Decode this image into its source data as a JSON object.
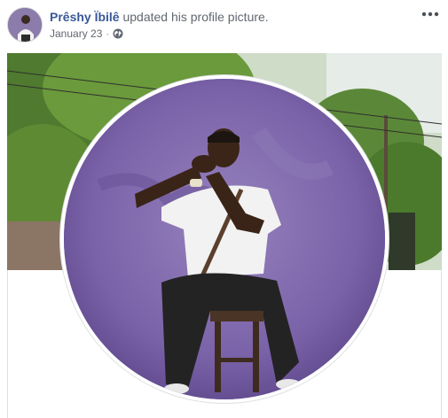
{
  "post": {
    "author_name": "Prêshy Ïbilê",
    "action_text": "updated his profile picture.",
    "date": "January 23",
    "separator": "·",
    "privacy_icon": "globe-icon",
    "more_icon": "more-horizontal-icon"
  },
  "colors": {
    "author_link": "#385898",
    "meta_text": "#616770",
    "backdrop_purple": "#7a62a8"
  }
}
